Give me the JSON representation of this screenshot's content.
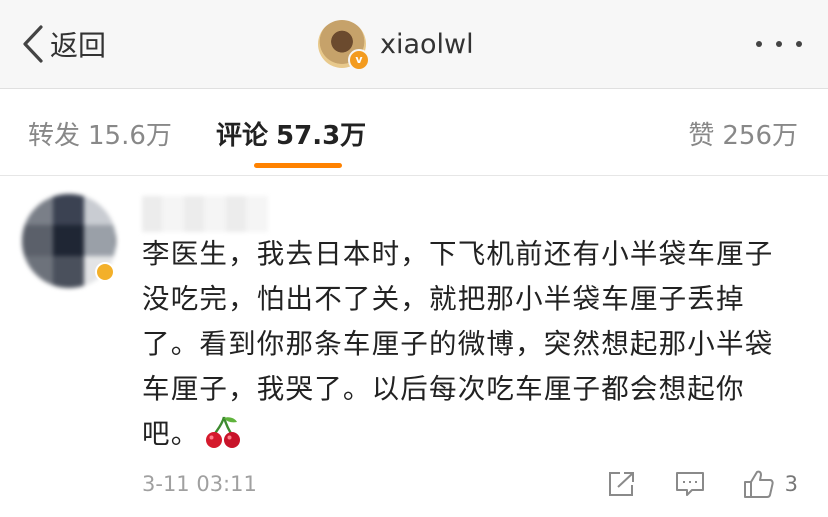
{
  "navbar": {
    "back_label": "返回",
    "username": "xiaolwl",
    "verified_badge": "v"
  },
  "tabs": [
    {
      "label": "转发",
      "count": "15.6万"
    },
    {
      "label": "评论",
      "count": "57.3万",
      "active": true
    },
    {
      "label": "赞",
      "count": "256万"
    }
  ],
  "colors": {
    "accent": "#ff8200",
    "navbar_bg": "#f7f7f7",
    "muted_text": "#a0a0a0"
  },
  "comment": {
    "text": "李医生，我去日本时，下飞机前还有小半袋车厘子没吃完，怕出不了关，就把那小半袋车厘子丢掉了。看到你那条车厘子的微博，突然想起那小半袋车厘子，我哭了。以后每次吃车厘子都会想起你吧。",
    "emoji": "cherry-icon",
    "time": "3-11 03:11",
    "like_count": "3"
  },
  "icons": [
    "chevron-left-icon",
    "more-icon",
    "share-icon",
    "comment-icon",
    "thumbs-up-icon",
    "cherry-icon"
  ]
}
